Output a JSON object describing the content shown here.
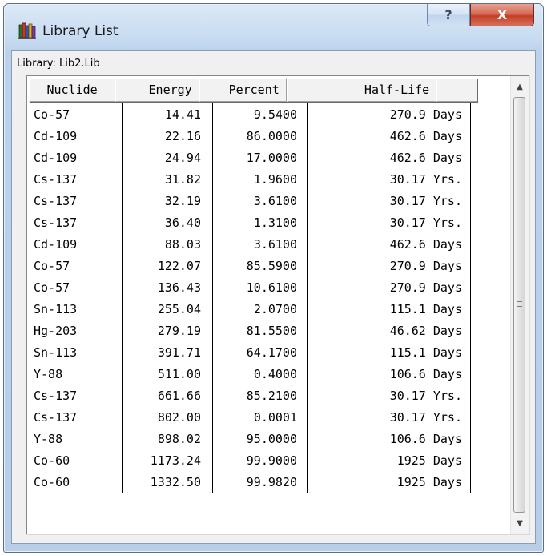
{
  "window": {
    "title": "Library List",
    "help_glyph": "?",
    "close_glyph": "X"
  },
  "library_label": "Library: Lib2.Lib",
  "columns": [
    "Nuclide",
    "Energy",
    "Percent",
    "Half-Life",
    ""
  ],
  "rows": [
    {
      "nuclide": "Co-57",
      "energy": "14.41",
      "percent": "9.5400",
      "half_life": "270.9 Days"
    },
    {
      "nuclide": "Cd-109",
      "energy": "22.16",
      "percent": "86.0000",
      "half_life": "462.6 Days"
    },
    {
      "nuclide": "Cd-109",
      "energy": "24.94",
      "percent": "17.0000",
      "half_life": "462.6 Days"
    },
    {
      "nuclide": "Cs-137",
      "energy": "31.82",
      "percent": "1.9600",
      "half_life": "30.17 Yrs."
    },
    {
      "nuclide": "Cs-137",
      "energy": "32.19",
      "percent": "3.6100",
      "half_life": "30.17 Yrs."
    },
    {
      "nuclide": "Cs-137",
      "energy": "36.40",
      "percent": "1.3100",
      "half_life": "30.17 Yrs."
    },
    {
      "nuclide": "Cd-109",
      "energy": "88.03",
      "percent": "3.6100",
      "half_life": "462.6 Days"
    },
    {
      "nuclide": "Co-57",
      "energy": "122.07",
      "percent": "85.5900",
      "half_life": "270.9 Days"
    },
    {
      "nuclide": "Co-57",
      "energy": "136.43",
      "percent": "10.6100",
      "half_life": "270.9 Days"
    },
    {
      "nuclide": "Sn-113",
      "energy": "255.04",
      "percent": "2.0700",
      "half_life": "115.1 Days"
    },
    {
      "nuclide": "Hg-203",
      "energy": "279.19",
      "percent": "81.5500",
      "half_life": "46.62 Days"
    },
    {
      "nuclide": "Sn-113",
      "energy": "391.71",
      "percent": "64.1700",
      "half_life": "115.1 Days"
    },
    {
      "nuclide": "Y-88",
      "energy": "511.00",
      "percent": "0.4000",
      "half_life": "106.6 Days"
    },
    {
      "nuclide": "Cs-137",
      "energy": "661.66",
      "percent": "85.2100",
      "half_life": "30.17 Yrs."
    },
    {
      "nuclide": "Cs-137",
      "energy": "802.00",
      "percent": "0.0001",
      "half_life": "30.17 Yrs."
    },
    {
      "nuclide": "Y-88",
      "energy": "898.02",
      "percent": "95.0000",
      "half_life": "106.6 Days"
    },
    {
      "nuclide": "Co-60",
      "energy": "1173.24",
      "percent": "99.9000",
      "half_life": "1925 Days"
    },
    {
      "nuclide": "Co-60",
      "energy": "1332.50",
      "percent": "99.9820",
      "half_life": "1925 Days"
    }
  ],
  "scrollbar": {
    "up_glyph": "▲",
    "down_glyph": "▼"
  },
  "icons": {
    "app": "books-icon",
    "help": "help-icon",
    "close": "close-icon"
  },
  "colors": {
    "close_button": "#c13f26",
    "frame": "#b7cde8",
    "client": "#f0f0f0"
  }
}
